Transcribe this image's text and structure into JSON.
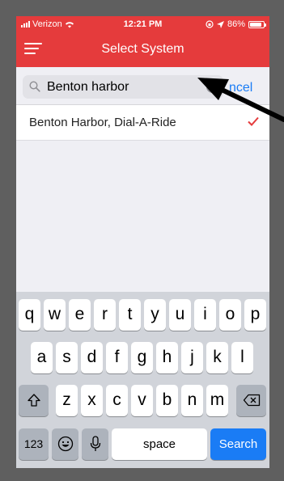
{
  "status": {
    "carrier": "Verizon",
    "time": "12:21 PM",
    "battery": "86%",
    "battery_level": 0.86
  },
  "nav": {
    "title": "Select System",
    "menu_icon": "hamburger-menu-icon"
  },
  "search": {
    "value": "Benton harbor",
    "cancel_label": "Cancel",
    "cancel_visible": "ncel"
  },
  "results": [
    {
      "label": "Benton Harbor, Dial-A-Ride",
      "selected": true
    }
  ],
  "keyboard": {
    "row1": [
      "q",
      "w",
      "e",
      "r",
      "t",
      "y",
      "u",
      "i",
      "o",
      "p"
    ],
    "row2": [
      "a",
      "s",
      "d",
      "f",
      "g",
      "h",
      "j",
      "k",
      "l"
    ],
    "row3": [
      "z",
      "x",
      "c",
      "v",
      "b",
      "n",
      "m"
    ],
    "numbers_label": "123",
    "space_label": "space",
    "search_label": "Search"
  },
  "colors": {
    "header": "#e53b3c",
    "accent": "#1a7cf5"
  }
}
